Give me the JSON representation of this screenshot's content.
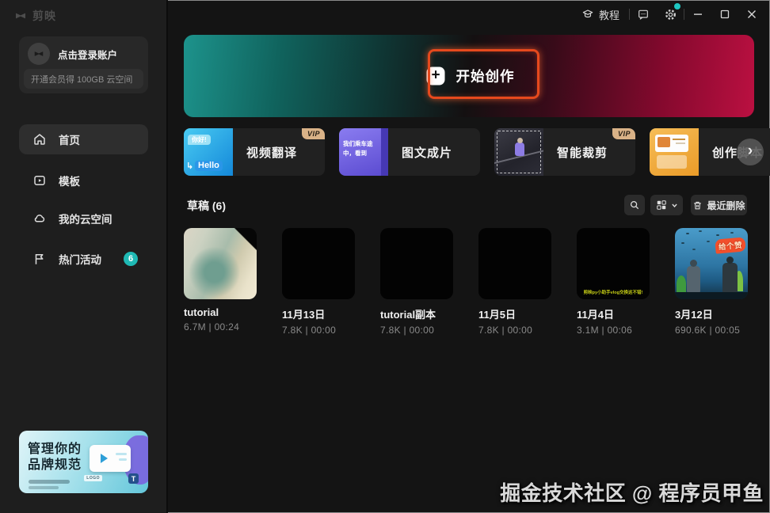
{
  "titlebar": {
    "app_name": "剪映",
    "tutorial_label": "教程",
    "notification_dot_color": "#1fc7c2",
    "icons": [
      "capcut-logo-icon",
      "graduation-cap-icon",
      "feedback-icon",
      "gear-icon",
      "minimize-icon",
      "maximize-icon",
      "close-icon"
    ]
  },
  "sidebar": {
    "login": {
      "label": "点击登录账户",
      "promo": "开通会员得 100GB 云空间"
    },
    "nav": [
      {
        "label": "首页",
        "icon": "home-icon",
        "active": true
      },
      {
        "label": "模板",
        "icon": "template-icon",
        "active": false
      },
      {
        "label": "我的云空间",
        "icon": "cloud-icon",
        "active": false
      },
      {
        "label": "热门活动",
        "icon": "flag-icon",
        "active": false,
        "badge": "6"
      }
    ],
    "brand_banner": {
      "title_line1": "管理你的",
      "title_line2": "品牌规范",
      "logo_tag": "LOGO",
      "text_tool": "T"
    }
  },
  "hero": {
    "cta_label": "开始创作",
    "plus_glyph": "+",
    "annotation_color": "#e6491d"
  },
  "features": [
    {
      "label": "视频翻译",
      "vip": "VIP",
      "bubble_top": "你好!",
      "bubble_bottom": "Hello",
      "bubble_arrow": "↳"
    },
    {
      "label": "图文成片",
      "caption": "我们乘车途中，看到"
    },
    {
      "label": "智能裁剪",
      "vip": "VIP"
    },
    {
      "label": "创作脚本"
    }
  ],
  "carousel": {
    "next_glyph": "›"
  },
  "drafts": {
    "header": "草稿 (6)",
    "recently_deleted_label": "最近删除",
    "items": [
      {
        "title": "tutorial",
        "meta": "6.7M | 00:24"
      },
      {
        "title": "11月13日",
        "meta": "7.8K | 00:00"
      },
      {
        "title": "tutorial副本",
        "meta": "7.8K | 00:00"
      },
      {
        "title": "11月5日",
        "meta": "7.8K | 00:00"
      },
      {
        "title": "11月4日",
        "meta": "3.1M | 00:06",
        "caption": "剪映py小助手vlog交换这不错!"
      },
      {
        "title": "3月12日",
        "meta": "690.6K | 00:05",
        "bubble": "给个赞"
      }
    ]
  },
  "watermark": "掘金技术社区 @ 程序员甲鱼"
}
